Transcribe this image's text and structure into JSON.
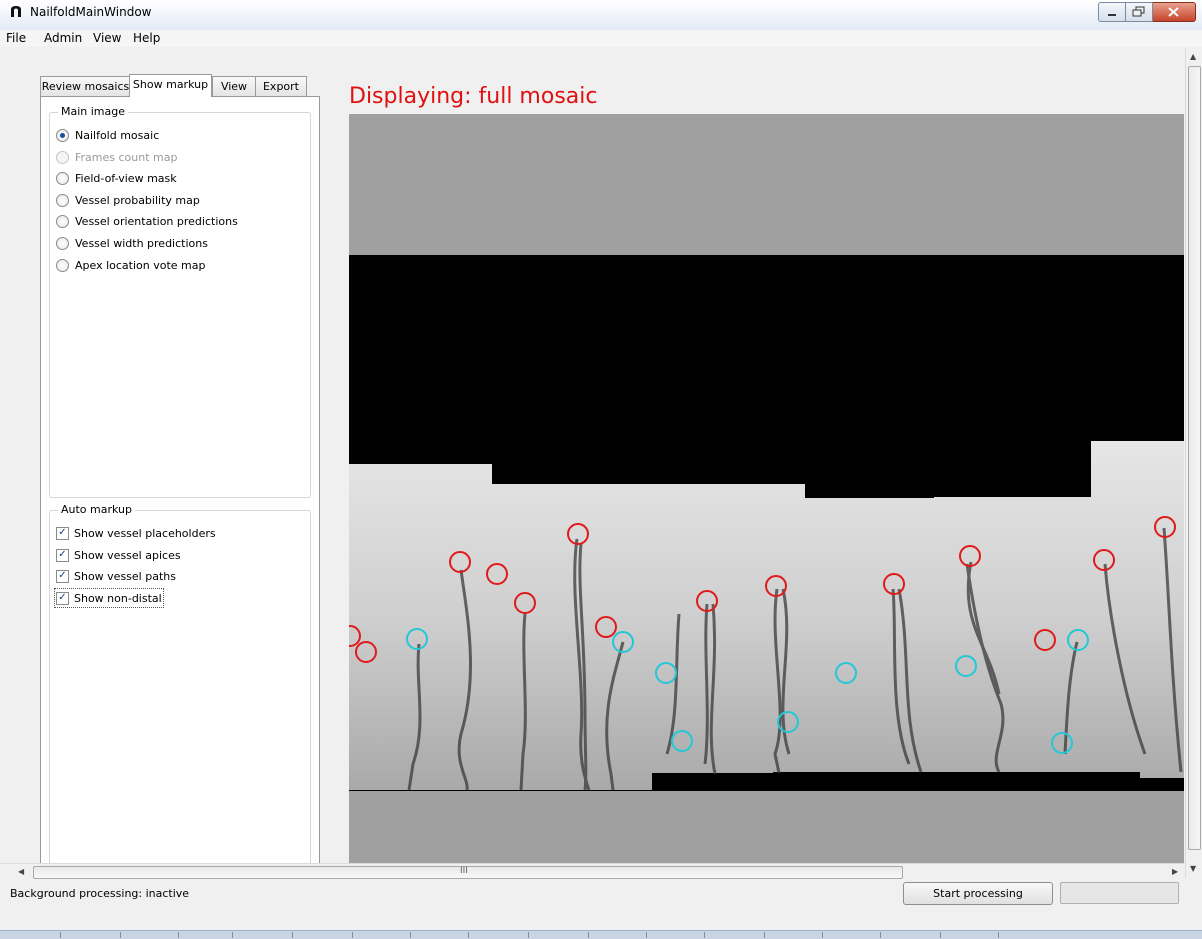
{
  "window": {
    "title": "NailfoldMainWindow"
  },
  "menu": [
    "File",
    "Admin",
    "View",
    "Help"
  ],
  "tabs": [
    "Review mosaics",
    "Show markup",
    "View",
    "Export"
  ],
  "active_tab": "Show markup",
  "main_image": {
    "title": "Main image",
    "options": [
      {
        "label": "Nailfold mosaic",
        "selected": true,
        "enabled": true
      },
      {
        "label": "Frames count map",
        "selected": false,
        "enabled": false
      },
      {
        "label": "Field-of-view mask",
        "selected": false,
        "enabled": true
      },
      {
        "label": "Vessel probability map",
        "selected": false,
        "enabled": true
      },
      {
        "label": "Vessel orientation predictions",
        "selected": false,
        "enabled": true
      },
      {
        "label": "Vessel width predictions",
        "selected": false,
        "enabled": true
      },
      {
        "label": "Apex location vote map",
        "selected": false,
        "enabled": true
      }
    ]
  },
  "auto_markup": {
    "title": "Auto markup",
    "options": [
      {
        "label": "Show vessel placeholders",
        "checked": true
      },
      {
        "label": "Show vessel apices",
        "checked": true
      },
      {
        "label": "Show vessel paths",
        "checked": true
      },
      {
        "label": "Show non-distal",
        "checked": true
      }
    ]
  },
  "display_label": "Displaying: full mosaic",
  "scroll_marker": "III",
  "status": {
    "text": "Background processing: inactive",
    "button": "Start processing"
  },
  "colors": {
    "display_label": "#e11010",
    "distal_marker": "#e01a1a",
    "non_distal_marker": "#22c8d8",
    "viewer_background": "#a0a0a0"
  }
}
